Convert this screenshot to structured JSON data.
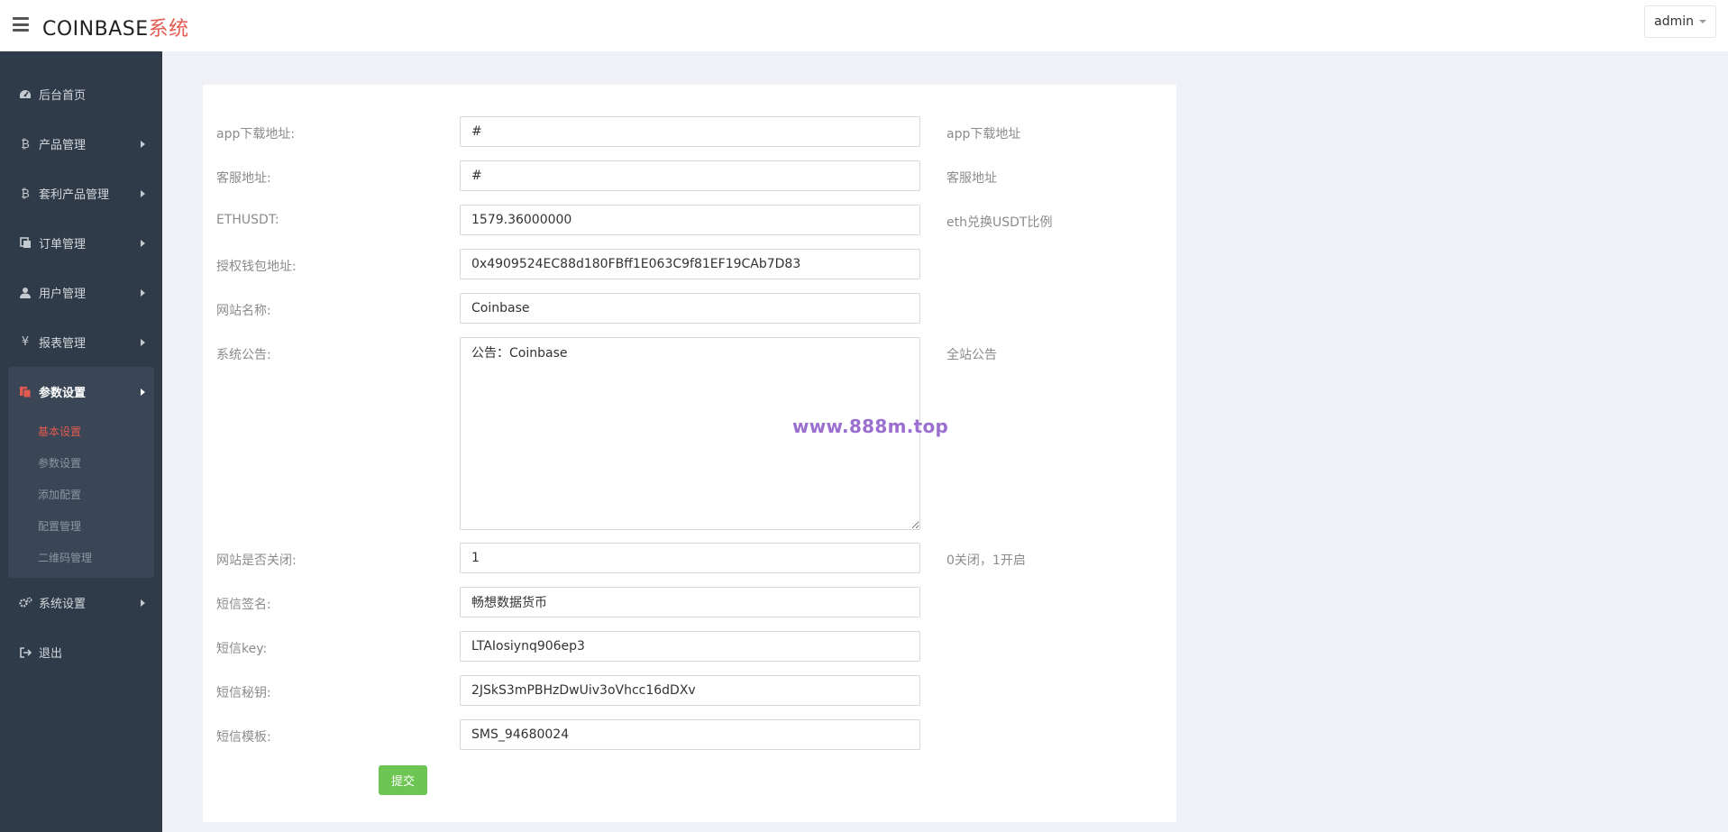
{
  "header": {
    "brand_main": "COINBASE",
    "brand_accent": "系统",
    "user_name": "admin",
    "menu_icon": "hamburger-menu-icon"
  },
  "sidebar": {
    "items": [
      {
        "label": "后台首页",
        "icon": "dashboard-icon"
      },
      {
        "label": "产品管理",
        "icon": "bitcoin-icon"
      },
      {
        "label": "套利产品管理",
        "icon": "bitcoin-icon"
      },
      {
        "label": "订单管理",
        "icon": "copy-icon"
      },
      {
        "label": "用户管理",
        "icon": "user-icon"
      },
      {
        "label": "报表管理",
        "icon": "yen-icon"
      },
      {
        "label": "参数设置",
        "icon": "files-icon"
      },
      {
        "label": "系统设置",
        "icon": "cogs-icon"
      },
      {
        "label": "退出",
        "icon": "sign-out-icon"
      }
    ],
    "sub_items": [
      "基本设置",
      "参数设置",
      "添加配置",
      "配置管理",
      "二维码管理"
    ]
  },
  "form": {
    "rows": [
      {
        "label": "app下载地址:",
        "value": "#",
        "hint": "app下载地址"
      },
      {
        "label": "客服地址:",
        "value": "#",
        "hint": "客服地址"
      },
      {
        "label": "ETHUSDT:",
        "value": "1579.36000000",
        "hint": "eth兑换USDT比例"
      },
      {
        "label": "授权钱包地址:",
        "value": "0x4909524EC88d180FBff1E063C9f81EF19CAb7D83",
        "hint": ""
      },
      {
        "label": "网站名称:",
        "value": "Coinbase",
        "hint": ""
      },
      {
        "label": "系统公告:",
        "value": "公告：Coinbase",
        "hint": "全站公告"
      },
      {
        "label": "网站是否关闭:",
        "value": "1",
        "hint": "0关闭，1开启"
      },
      {
        "label": "短信签名:",
        "value": "畅想数据货币",
        "hint": ""
      },
      {
        "label": "短信key:",
        "value": "LTAIosiynq906ep3",
        "hint": ""
      },
      {
        "label": "短信秘钥:",
        "value": "2JSkS3mPBHzDwUiv3oVhcc16dDXv",
        "hint": ""
      },
      {
        "label": "短信模板:",
        "value": "SMS_94680024",
        "hint": ""
      }
    ],
    "submit_label": "提交"
  },
  "watermark": "www.888m.top",
  "colors": {
    "sidebar_bg": "#2f3b49",
    "accent": "#e35b4f",
    "submit": "#6dc653",
    "watermark": "#9b6fd0"
  }
}
